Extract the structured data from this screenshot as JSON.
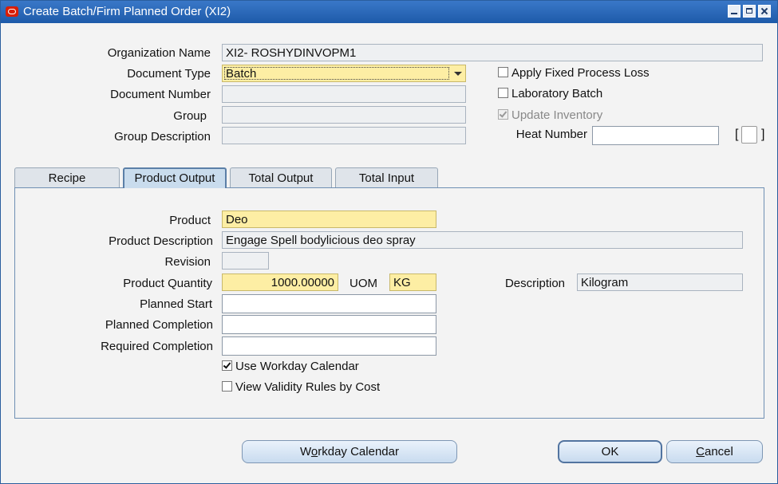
{
  "window": {
    "title": "Create Batch/Firm Planned Order (XI2)"
  },
  "header": {
    "organization_name_label": "Organization Name",
    "organization_name_value": "XI2- ROSHYDINVOPM1",
    "document_type_label": "Document Type",
    "document_type_value": "Batch",
    "document_number_label": "Document Number",
    "document_number_value": "",
    "group_label": "Group",
    "group_value": "",
    "group_description_label": "Group Description",
    "group_description_value": "",
    "apply_fixed_process_loss_label": "Apply Fixed Process Loss",
    "apply_fixed_process_loss_checked": false,
    "laboratory_batch_label": "Laboratory Batch",
    "laboratory_batch_checked": false,
    "update_inventory_label": "Update Inventory",
    "update_inventory_checked": true,
    "heat_number_label": "Heat Number",
    "heat_number_value": "",
    "bracket_open": "[",
    "bracket_close": "]"
  },
  "tabs": [
    {
      "label": "Recipe",
      "active": false
    },
    {
      "label": "Product Output",
      "active": true
    },
    {
      "label": "Total Output",
      "active": false
    },
    {
      "label": "Total Input",
      "active": false
    }
  ],
  "product_output": {
    "product_label": "Product",
    "product_value": "Deo",
    "product_description_label": "Product Description",
    "product_description_value": "Engage Spell bodylicious deo spray",
    "revision_label": "Revision",
    "revision_value": "",
    "product_quantity_label": "Product Quantity",
    "product_quantity_value": "1000.00000",
    "uom_label": "UOM",
    "uom_value": "KG",
    "description_label": "Description",
    "description_value": "Kilogram",
    "planned_start_label": "Planned Start",
    "planned_start_value": "",
    "planned_completion_label": "Planned Completion",
    "planned_completion_value": "",
    "required_completion_label": "Required Completion",
    "required_completion_value": "",
    "use_workday_calendar_label": "Use Workday Calendar",
    "use_workday_calendar_checked": true,
    "view_validity_rules_label": "View Validity Rules by Cost",
    "view_validity_rules_checked": false
  },
  "buttons": {
    "workday_calendar_pre": "W",
    "workday_calendar_mnemonic": "o",
    "workday_calendar_post": "rkday Calendar",
    "ok": "OK",
    "cancel_mnemonic": "C",
    "cancel_post": "ancel"
  },
  "colors": {
    "titlebar": "#1d5aa9",
    "required_field": "#fdeea4",
    "active_tab": "#c9dced"
  }
}
